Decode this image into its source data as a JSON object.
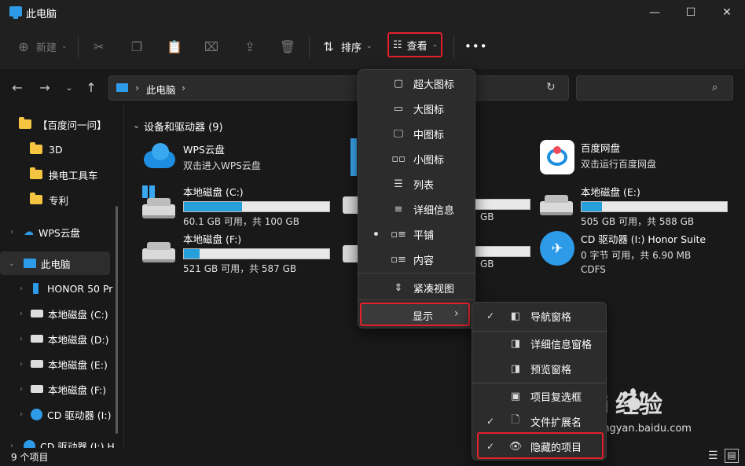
{
  "window": {
    "title": "此电脑",
    "minimize": "—",
    "maximize": "☐",
    "close": "✕"
  },
  "toolbar": {
    "new_label": "新建",
    "sort_label": "排序",
    "view_label": "查看",
    "more": "•••"
  },
  "address": {
    "separator": "›",
    "location": "此电脑"
  },
  "sidebar": {
    "items": [
      {
        "label": "【百度问一问】",
        "chevron": ""
      },
      {
        "label": "3D",
        "chevron": ""
      },
      {
        "label": "换电工具车",
        "chevron": ""
      },
      {
        "label": "专利",
        "chevron": ""
      },
      {
        "label": "WPS云盘",
        "chevron": "›"
      },
      {
        "label": "此电脑",
        "chevron": "⌄"
      },
      {
        "label": "HONOR 50 Pr",
        "chevron": "›"
      },
      {
        "label": "本地磁盘 (C:)",
        "chevron": "›"
      },
      {
        "label": "本地磁盘 (D:)",
        "chevron": "›"
      },
      {
        "label": "本地磁盘 (E:)",
        "chevron": "›"
      },
      {
        "label": "本地磁盘 (F:)",
        "chevron": "›"
      },
      {
        "label": "CD 驱动器 (I:)",
        "chevron": "›"
      },
      {
        "label": "CD 驱动器 (I:) H",
        "chevron": "›"
      }
    ]
  },
  "main": {
    "section_title": "设备和驱动器 (9)",
    "section_chevron": "⌄",
    "wps": {
      "name": "WPS云盘",
      "sub": "双击进入WPS云盘"
    },
    "baidu": {
      "name": "百度网盘",
      "sub": "双击运行百度网盘"
    },
    "drives": [
      {
        "name": "本地磁盘 (C:)",
        "size": "60.1 GB 可用，共 100 GB",
        "used": 0.4
      },
      {
        "name": "本地磁盘 (E:)",
        "size": "505 GB 可用，共 588 GB",
        "used": 0.14
      },
      {
        "name": "本地磁盘 (F:)",
        "size": "521 GB 可用，共 587 GB",
        "used": 0.11
      }
    ],
    "partial_sizes": [
      "GB",
      "GB"
    ],
    "cd": {
      "name": "CD 驱动器 (I:) Honor Suite",
      "size": "0 字节 可用，共 6.90 MB",
      "fs": "CDFS"
    }
  },
  "status": {
    "count": "9 个项目"
  },
  "view_menu": {
    "items": [
      {
        "label": "超大图标",
        "icon": "▢"
      },
      {
        "label": "大图标",
        "icon": "▭"
      },
      {
        "label": "中图标",
        "icon": "🖵"
      },
      {
        "label": "小图标",
        "icon": "▫▫"
      },
      {
        "label": "列表",
        "icon": "☰"
      },
      {
        "label": "详细信息",
        "icon": "≡"
      },
      {
        "label": "平铺",
        "icon": "▫≡"
      },
      {
        "label": "内容",
        "icon": "▫≡"
      },
      {
        "label": "紧凑视图",
        "icon": "⇕"
      },
      {
        "label": "显示",
        "icon": ""
      }
    ],
    "submenu_arrow": "›"
  },
  "show_menu": {
    "items": [
      {
        "label": "导航窗格",
        "checked": "✓"
      },
      {
        "label": "详细信息窗格",
        "checked": ""
      },
      {
        "label": "预览窗格",
        "checked": ""
      },
      {
        "label": "项目复选框",
        "checked": ""
      },
      {
        "label": "文件扩展名",
        "checked": "✓"
      },
      {
        "label": "隐藏的项目",
        "checked": "✓"
      }
    ]
  },
  "watermark": {
    "brand": "Bai  经验",
    "url": "jingyan.baidu.com"
  }
}
